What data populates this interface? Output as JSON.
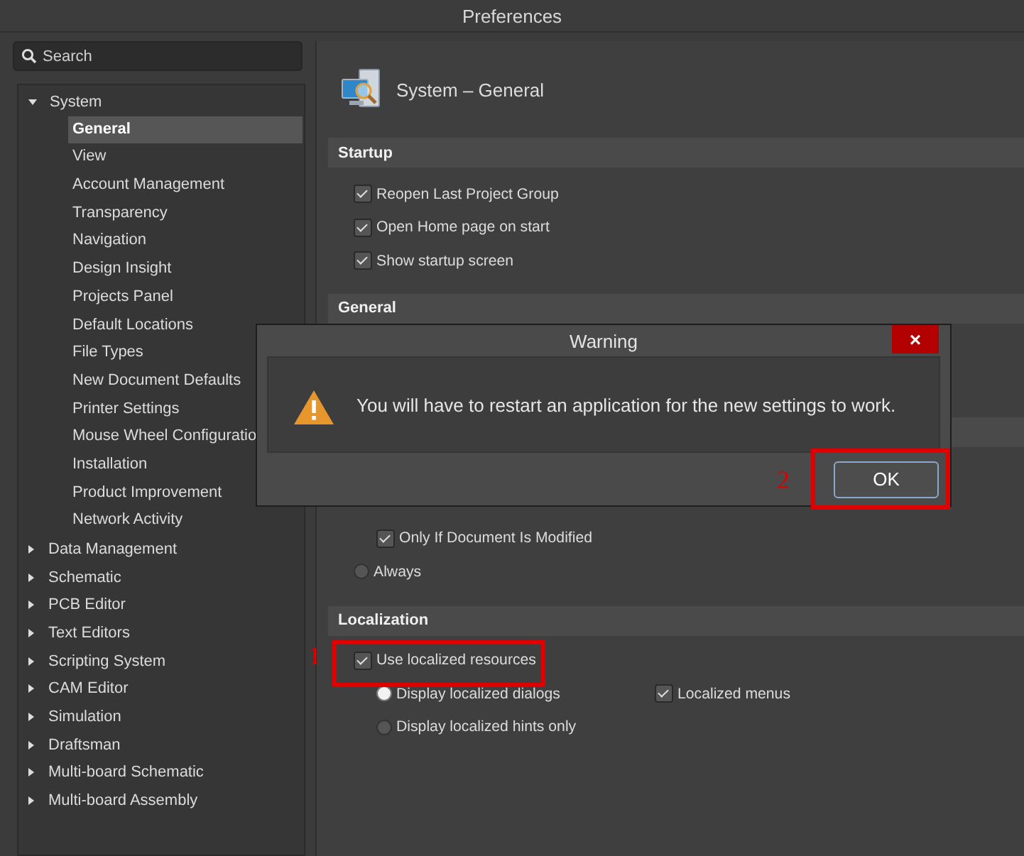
{
  "window": {
    "title": "Preferences"
  },
  "sidebar": {
    "search": {
      "placeholder": "Search"
    },
    "tree": [
      {
        "label": "System",
        "expanded": true,
        "selected": false,
        "children": [
          {
            "label": "General",
            "selected": true
          },
          {
            "label": "View",
            "selected": false
          },
          {
            "label": "Account Management",
            "selected": false
          },
          {
            "label": "Transparency",
            "selected": false
          },
          {
            "label": "Navigation",
            "selected": false
          },
          {
            "label": "Design Insight",
            "selected": false
          },
          {
            "label": "Projects Panel",
            "selected": false
          },
          {
            "label": "Default Locations",
            "selected": false
          },
          {
            "label": "File Types",
            "selected": false
          },
          {
            "label": "New Document Defaults",
            "selected": false
          },
          {
            "label": "Printer Settings",
            "selected": false
          },
          {
            "label": "Mouse Wheel Configuratio",
            "selected": false
          },
          {
            "label": "Installation",
            "selected": false
          },
          {
            "label": "Product Improvement",
            "selected": false
          },
          {
            "label": "Network Activity",
            "selected": false
          }
        ]
      },
      {
        "label": "Data Management",
        "expanded": false,
        "selected": false
      },
      {
        "label": "Schematic",
        "expanded": false,
        "selected": false
      },
      {
        "label": "PCB Editor",
        "expanded": false,
        "selected": false
      },
      {
        "label": "Text Editors",
        "expanded": false,
        "selected": false
      },
      {
        "label": "Scripting System",
        "expanded": false,
        "selected": false
      },
      {
        "label": "CAM Editor",
        "expanded": false,
        "selected": false
      },
      {
        "label": "Simulation",
        "expanded": false,
        "selected": false
      },
      {
        "label": "Draftsman",
        "expanded": false,
        "selected": false
      },
      {
        "label": "Multi-board Schematic",
        "expanded": false,
        "selected": false
      },
      {
        "label": "Multi-board Assembly",
        "expanded": false,
        "selected": false
      }
    ]
  },
  "page": {
    "title": "System – General",
    "sections": [
      {
        "title": "Startup",
        "rows": [
          {
            "kind": "checkbox",
            "label": "Reopen Last Project Group",
            "checked": true
          },
          {
            "kind": "checkbox",
            "label": "Open Home page on start",
            "checked": true
          },
          {
            "kind": "checkbox",
            "label": "Show startup screen",
            "checked": true
          }
        ]
      },
      {
        "title": "General"
      },
      {
        "rows": [
          {
            "kind": "subcheckbox",
            "label": "Only If Document Is Modified",
            "checked": true
          },
          {
            "kind": "radio",
            "label": "Always",
            "selected": false
          }
        ]
      },
      {
        "title": "Localization",
        "rows": [
          {
            "kind": "checkbox",
            "label": "Use localized resources",
            "checked": true,
            "children": [
              {
                "kind": "radio",
                "label": "Display localized dialogs",
                "selected": true
              },
              {
                "kind": "checkbox",
                "label": "Localized menus",
                "checked": true
              },
              {
                "kind": "radio",
                "label": "Display localized hints only",
                "selected": false
              }
            ]
          }
        ]
      }
    ]
  },
  "dialog": {
    "title": "Warning",
    "close": "×",
    "message": "You will have to restart an application for the new settings to work.",
    "buttons": [
      "OK"
    ]
  },
  "annotations": [
    {
      "label": "1"
    },
    {
      "label": "2"
    }
  ]
}
